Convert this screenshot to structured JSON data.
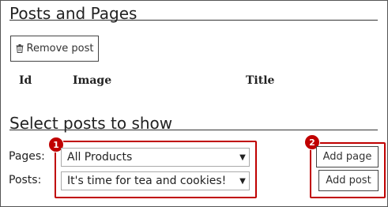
{
  "posts_and_pages": {
    "title": "Posts and Pages",
    "remove_button_label": "Remove post",
    "remove_icon": "trash-icon",
    "columns": [
      "Id",
      "Image",
      "Title"
    ]
  },
  "select_section": {
    "title": "Select posts to show",
    "pages_label": "Pages:",
    "pages_value": "All Products",
    "posts_label": "Posts:",
    "posts_value": "It's time for tea and cookies!",
    "add_page_label": "Add page",
    "add_post_label": "Add post"
  },
  "callouts": {
    "badge_1": "1",
    "badge_2": "2",
    "color": "#c00000"
  }
}
